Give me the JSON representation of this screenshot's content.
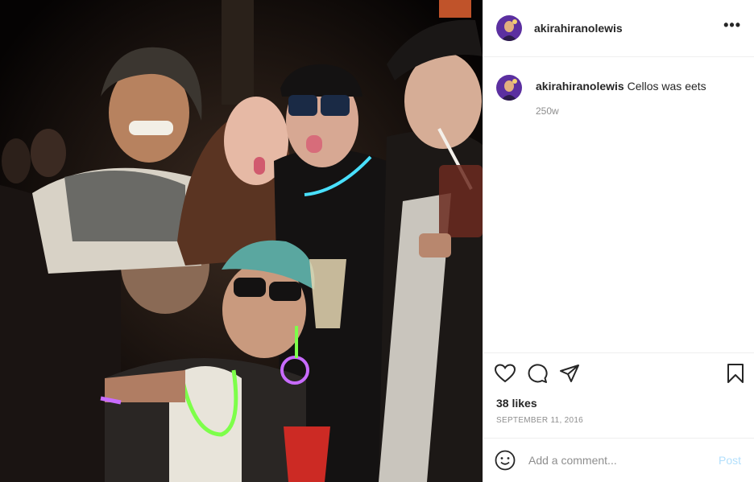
{
  "post": {
    "username": "akirahiranolewis",
    "more_icon": "more-horizontal-icon"
  },
  "caption": {
    "username": "akirahiranolewis",
    "text": "Cellos was eets",
    "time": "250w"
  },
  "actions": {
    "like_icon": "heart-icon",
    "comment_icon": "comment-icon",
    "share_icon": "share-icon",
    "save_icon": "bookmark-icon"
  },
  "likes": "38 likes",
  "date": "SEPTEMBER 11, 2016",
  "add_comment": {
    "emoji_icon": "emoji-icon",
    "placeholder": "Add a comment...",
    "post_label": "Post"
  },
  "colors": {
    "post_button_disabled": "#b2dffc",
    "secondary_text": "#8e8e8e",
    "glowstick_green": "#7dff4a",
    "glowstick_blue": "#49e0ff",
    "glowstick_purple": "#c86bff"
  }
}
